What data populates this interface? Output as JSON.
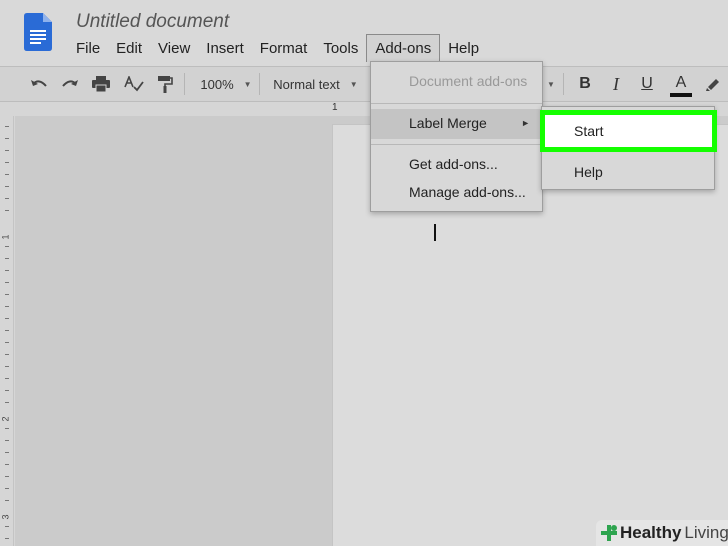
{
  "document": {
    "title": "Untitled document"
  },
  "menubar": {
    "items": [
      {
        "label": "File"
      },
      {
        "label": "Edit"
      },
      {
        "label": "View"
      },
      {
        "label": "Insert"
      },
      {
        "label": "Format"
      },
      {
        "label": "Tools"
      },
      {
        "label": "Add-ons"
      },
      {
        "label": "Help"
      }
    ],
    "active": "Add-ons"
  },
  "toolbar": {
    "zoom": "100%",
    "style": "Normal text",
    "bold": "B",
    "italic": "I",
    "underline": "U",
    "text_color": "A"
  },
  "ruler": {
    "top_number": "1",
    "left_numbers": [
      "1",
      "2",
      "3"
    ]
  },
  "addons_menu": {
    "document_addons": "Document add-ons",
    "label_merge": "Label Merge",
    "get_addons": "Get add-ons...",
    "manage_addons": "Manage add-ons..."
  },
  "label_merge_submenu": {
    "start": "Start",
    "help": "Help"
  },
  "watermark": {
    "brand1": "Healthy",
    "brand2": "Living"
  },
  "colors": {
    "highlight": "#14ff00",
    "docs_blue": "#2a6bd6",
    "watermark_green": "#2ea44f"
  }
}
